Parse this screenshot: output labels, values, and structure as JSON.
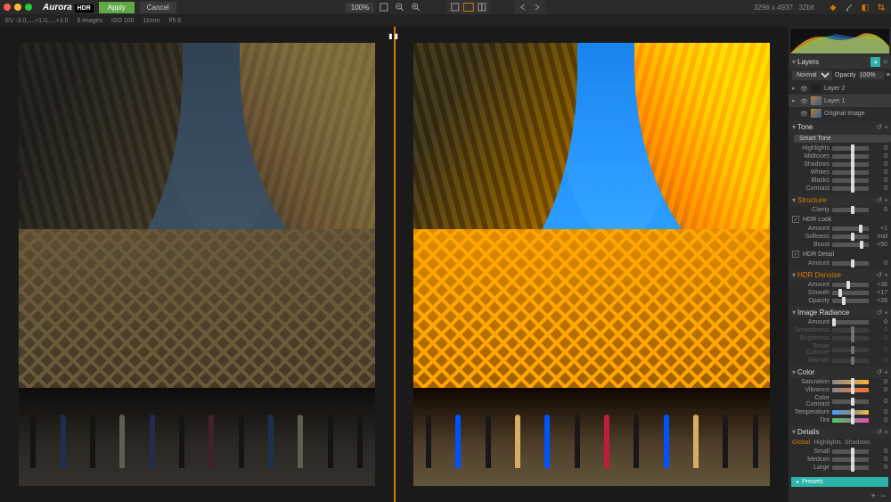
{
  "app": {
    "name": "Aurora",
    "badge": "HDR"
  },
  "topbar": {
    "apply": "Apply",
    "cancel": "Cancel",
    "zoom": "100%",
    "dimensions": "3296 x 4937",
    "bitdepth": "32bit"
  },
  "infobar": {
    "ev": "EV -3.0,...,+1.0,...,+3.0",
    "images": "5 images",
    "iso": "ISO 100",
    "focal": "11mm",
    "aperture": "f/5.6"
  },
  "histogram": {
    "label": "Histogram"
  },
  "layers": {
    "title": "Layers",
    "blend_mode": "Normal",
    "opacity_label": "Opacity",
    "opacity": "100%",
    "items": [
      {
        "name": "Layer 2",
        "selected": false,
        "thumb": "blank"
      },
      {
        "name": "Layer 1",
        "selected": true,
        "thumb": "img"
      },
      {
        "name": "Original Image",
        "selected": false,
        "thumb": "img"
      }
    ]
  },
  "tone": {
    "title": "Tone",
    "smart_tone": "Smart Tone",
    "sliders": {
      "highlights": {
        "label": "Highlights",
        "val": "0",
        "pos": 50
      },
      "midtones": {
        "label": "Midtones",
        "val": "0",
        "pos": 50
      },
      "shadows": {
        "label": "Shadows",
        "val": "0",
        "pos": 50
      },
      "whites": {
        "label": "Whites",
        "val": "0",
        "pos": 50
      },
      "blacks": {
        "label": "Blacks",
        "val": "0",
        "pos": 50
      },
      "contrast": {
        "label": "Contrast",
        "val": "0",
        "pos": 50
      }
    }
  },
  "structure": {
    "title": "Structure",
    "clarity": {
      "label": "Clarity",
      "val": "0",
      "pos": 50
    },
    "hdr_look": "HDR Look",
    "amount": {
      "label": "Amount",
      "val": "+1",
      "pos": 72
    },
    "softness": {
      "label": "Softness",
      "val": "mid",
      "pos": 50
    },
    "boost": {
      "label": "Boost",
      "val": "+50",
      "pos": 75
    },
    "hdr_detail": "HDR Detail",
    "detail_amount": {
      "label": "Amount",
      "val": "0",
      "pos": 50
    }
  },
  "denoise": {
    "title": "HDR Denoise",
    "amount": {
      "label": "Amount",
      "val": "+38",
      "pos": 38
    },
    "smooth": {
      "label": "Smooth",
      "val": "+17",
      "pos": 17
    },
    "opacity": {
      "label": "Opacity",
      "val": "+28",
      "pos": 28
    }
  },
  "radiance": {
    "title": "Image Radiance",
    "amount": {
      "label": "Amount",
      "val": "0",
      "pos": 0
    },
    "smoothness": {
      "label": "Smoothness",
      "val": "0",
      "pos": 50
    },
    "brightness": {
      "label": "Brightness",
      "val": "0",
      "pos": 50
    },
    "smartcolor": {
      "label": "Smart Colorize",
      "val": "0",
      "pos": 50
    },
    "warmth": {
      "label": "Warmth",
      "val": "0",
      "pos": 50
    }
  },
  "color": {
    "title": "Color",
    "saturation": {
      "label": "Saturation",
      "val": "0",
      "pos": 50
    },
    "vibrance": {
      "label": "Vibrance",
      "val": "0",
      "pos": 50
    },
    "colorcontrast": {
      "label": "Color Contrast",
      "val": "0",
      "pos": 50
    },
    "temperature": {
      "label": "Temperature",
      "val": "0",
      "pos": 50
    },
    "tint": {
      "label": "Tint",
      "val": "0",
      "pos": 50
    }
  },
  "details": {
    "title": "Details",
    "tabs": {
      "global": "Global",
      "highlights": "Highlights",
      "shadows": "Shadows"
    },
    "small": {
      "label": "Small",
      "val": "0",
      "pos": 50
    },
    "medium": {
      "label": "Medium",
      "val": "0",
      "pos": 50
    },
    "large": {
      "label": "Large",
      "val": "0",
      "pos": 50
    }
  },
  "presets": {
    "label": "Presets"
  }
}
